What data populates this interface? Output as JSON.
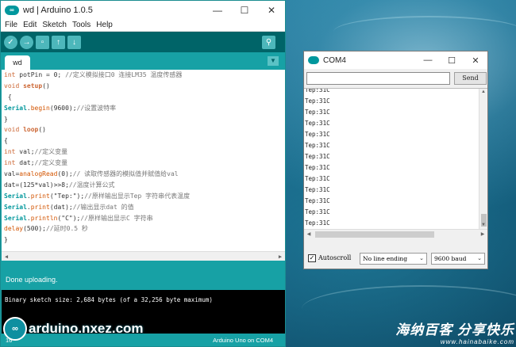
{
  "ide": {
    "title": "wd | Arduino 1.0.5",
    "menu": [
      "File",
      "Edit",
      "Sketch",
      "Tools",
      "Help"
    ],
    "toolbar": {
      "icons": [
        "verify-icon",
        "upload-icon",
        "new-icon",
        "open-icon",
        "save-icon",
        "serial-monitor-icon"
      ]
    },
    "tab_label": "wd",
    "code_lines": [
      "int potPin = 0; //定义模拟接口0 连接LM35 温度传感器",
      "void setup()",
      " {",
      "Serial.begin(9600);//设置波特率",
      "}",
      "void loop()",
      "{",
      "int val;//定义变量",
      "int dat;//定义变量",
      "val=analogRead(0);// 读取传感器的模拟值并赋值给val",
      "dat=(125*val)>>8;//温度计算公式",
      "Serial.print(\"Tep:\");//原样输出显示Tep 字符串代表温度",
      "Serial.print(dat);//输出显示dat 的值",
      "Serial.println(\"C\");//原样输出显示C 字符串",
      "delay(500);//延时0.5 秒",
      "}"
    ],
    "status_message": "Done uploading.",
    "console_output": "Binary sketch size: 2,684 bytes (of a 32,256 byte maximum)",
    "line_number": "16",
    "board": "Arduino Uno on COM4"
  },
  "serial_monitor": {
    "title": "COM4",
    "send_label": "Send",
    "input_value": "",
    "output_lines": [
      "Tep:31C",
      "Tep:31C",
      "Tep:31C",
      "Tep:31C",
      "Tep:31C",
      "Tep:31C",
      "Tep:31C",
      "Tep:31C",
      "Tep:31C",
      "Tep:31C",
      "Tep:31C",
      "Tep:31C",
      "Tep:31C",
      "Tep:3"
    ],
    "autoscroll_label": "Autoscroll",
    "autoscroll_checked": true,
    "line_ending": "No line ending",
    "baud_rate": "9600 baud"
  },
  "watermarks": {
    "arduino_logo": "∞",
    "arduino_site": "arduino.nxez.com",
    "cn_brand": "海纳百客 分享快乐",
    "cn_url": "www.hainabaike.com"
  },
  "colors": {
    "arduino_teal": "#17a1a5",
    "arduino_dark": "#006468",
    "editor_bg": "#ffffff",
    "console_bg": "#000000"
  }
}
